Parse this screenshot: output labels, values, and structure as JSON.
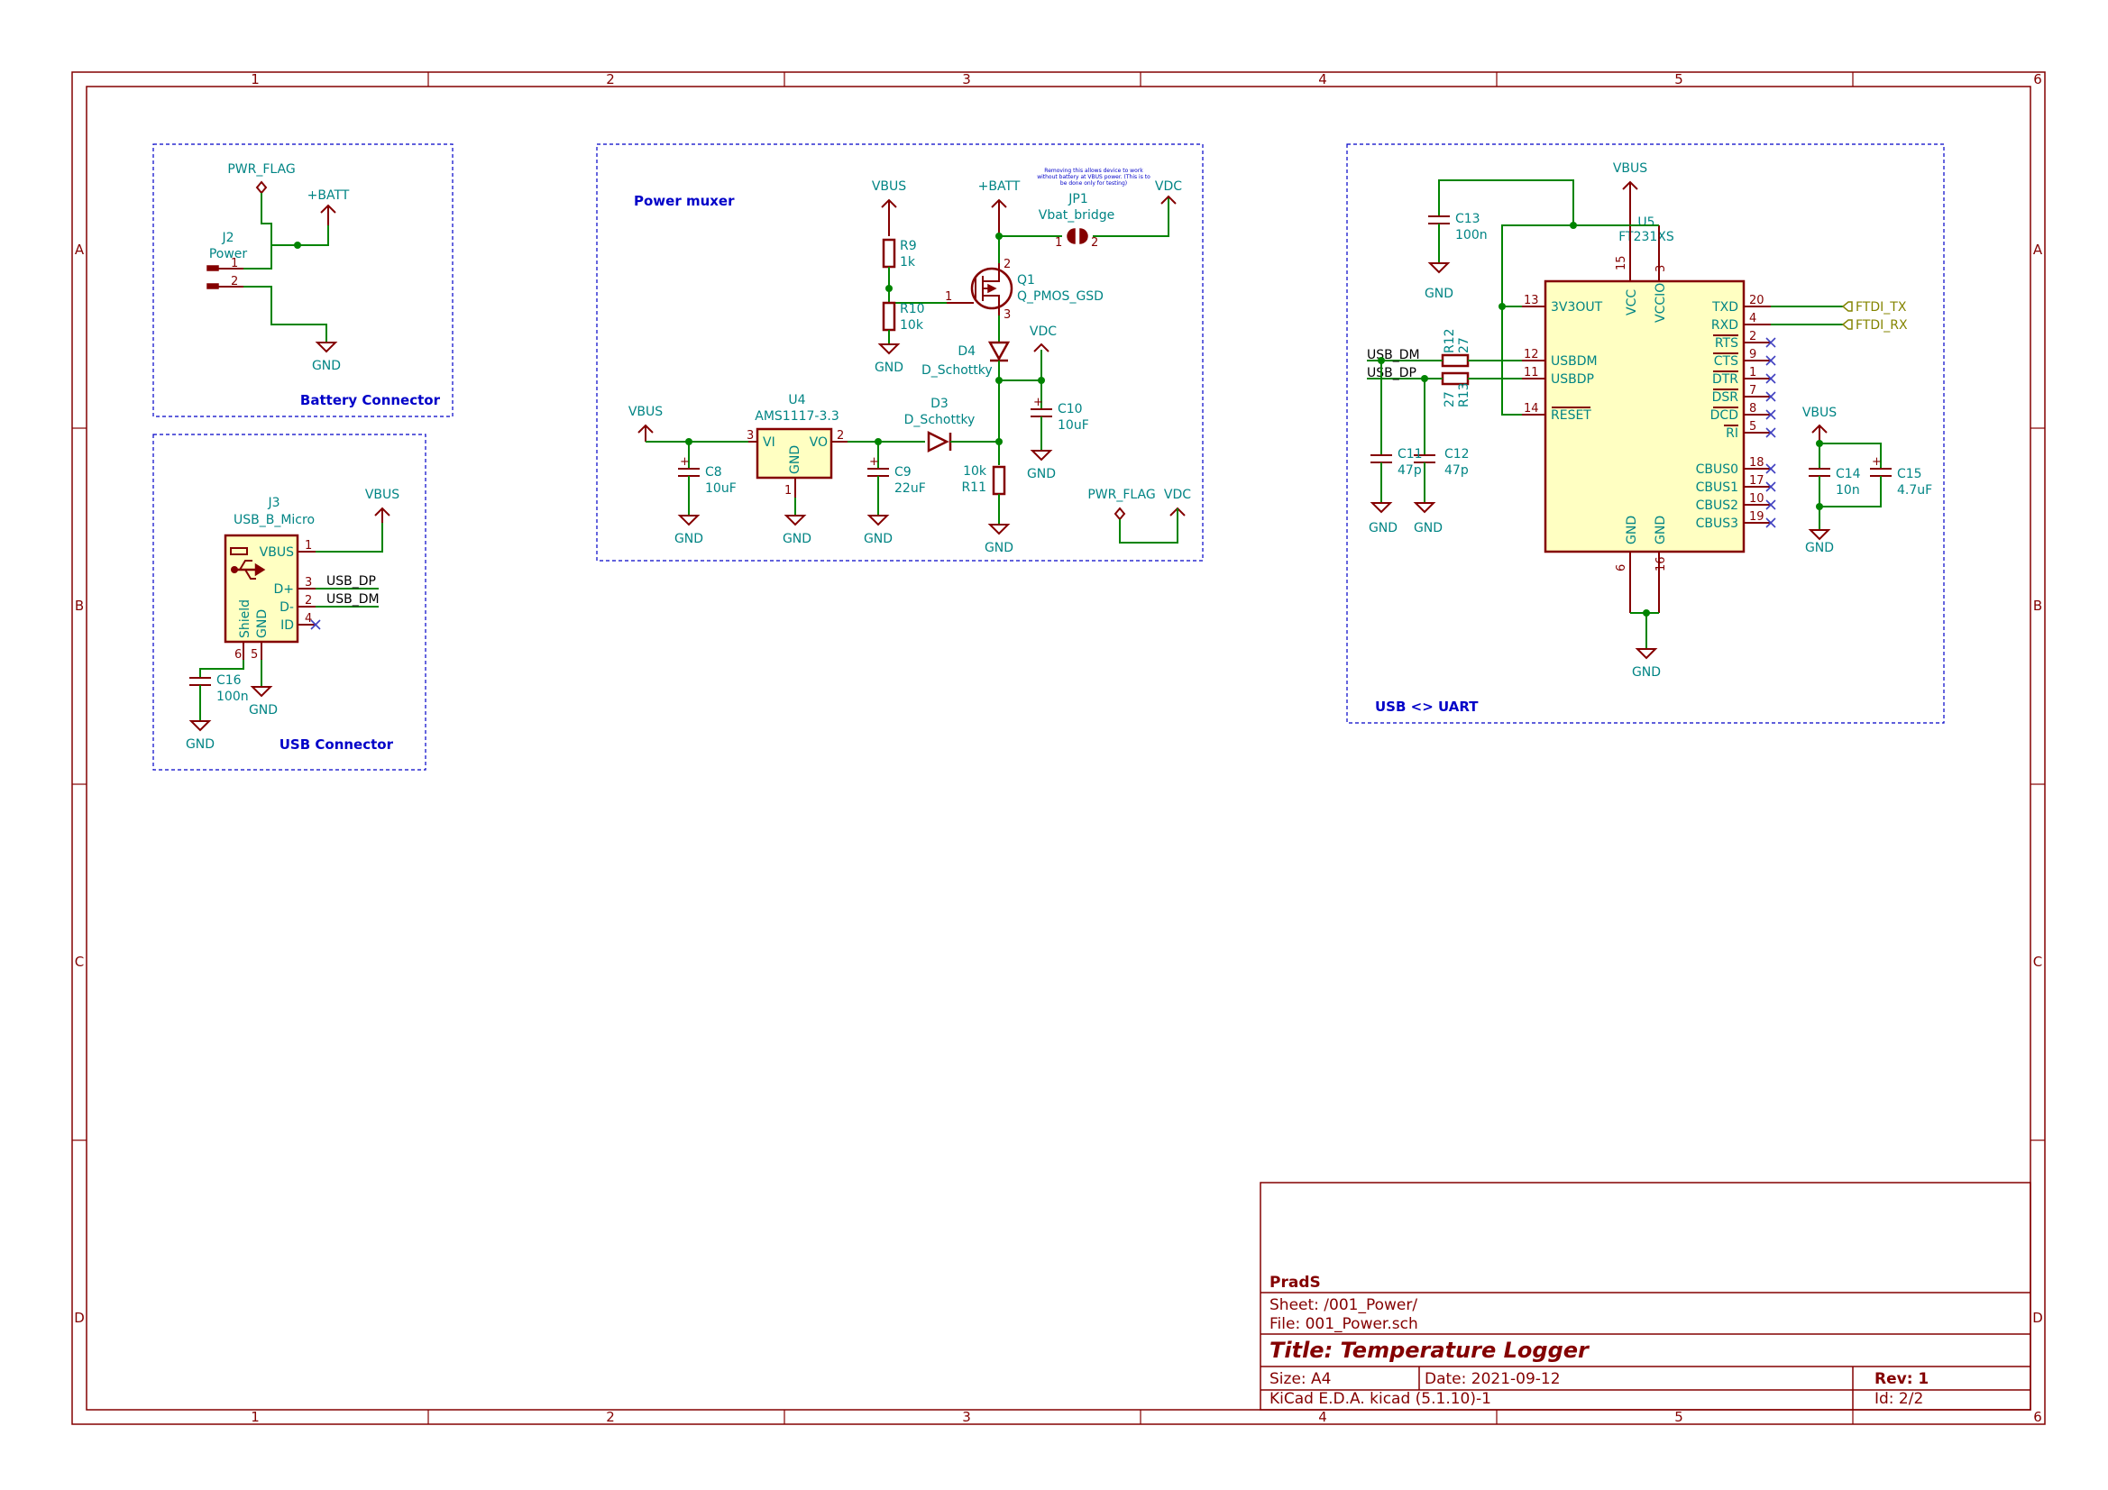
{
  "page": {
    "columns": [
      "1",
      "2",
      "3",
      "4",
      "5",
      "6"
    ],
    "rows": [
      "A",
      "B",
      "C",
      "D"
    ]
  },
  "sections": {
    "battery": "Battery Connector",
    "usb": "USB Connector",
    "power": "Power muxer",
    "uart": "USB <> UART"
  },
  "battery": {
    "pwrflag": "PWR_FLAG",
    "batt": "+BATT",
    "j2_ref": "J2",
    "j2_val": "Power",
    "pin1": "1",
    "pin2": "2",
    "gnd": "GND"
  },
  "usbconn": {
    "j3_ref": "J3",
    "j3_val": "USB_B_Micro",
    "vbus_pin": "VBUS",
    "dp_pin": "D+",
    "dm_pin": "D-",
    "id_pin": "ID",
    "gnd_pin": "GND",
    "shield_pin": "Shield",
    "p1": "1",
    "p2": "2",
    "p3": "3",
    "p4": "4",
    "p5": "5",
    "p6": "6",
    "usb_dp": "USB_DP",
    "usb_dm": "USB_DM",
    "vbus": "VBUS",
    "c16_ref": "C16",
    "c16_val": "100n",
    "gnd": "GND"
  },
  "power": {
    "note": "Removing this allows device to work without battery at VBUS power. (This is to be done only for testing)",
    "vbus": "VBUS",
    "batt": "+BATT",
    "vdc": "VDC",
    "jp1_ref": "JP1",
    "jp1_val": "Vbat_bridge",
    "r9_ref": "R9",
    "r9_val": "1k",
    "r10_ref": "R10",
    "r10_val": "10k",
    "q1_ref": "Q1",
    "q1_val": "Q_PMOS_GSD",
    "d4_ref": "D4",
    "d4_val": "D_Schottky",
    "d3_ref": "D3",
    "d3_val": "D_Schottky",
    "u4_ref": "U4",
    "u4_val": "AMS1117-3.3",
    "vi": "VI",
    "vo": "VO",
    "u4_gnd": "GND",
    "c8_ref": "C8",
    "c8_val": "10uF",
    "c9_ref": "C9",
    "c9_val": "22uF",
    "c10_ref": "C10",
    "c10_val": "10uF",
    "r11_ref": "R11",
    "r11_val": "10k",
    "pwrflag": "PWR_FLAG",
    "gnd": "GND",
    "n1": "1",
    "n2": "2",
    "n3": "3"
  },
  "uart": {
    "vbus": "VBUS",
    "c13_ref": "C13",
    "c13_val": "100n",
    "u5_ref": "U5",
    "u5_val": "FT231XS",
    "pin_3v3": "3V3OUT",
    "pin_vcc": "VCC",
    "pin_vccio": "VCCIO",
    "pin_usbdm": "USBDM",
    "pin_usbdp": "USBDP",
    "pin_reset": "RESET",
    "pin_gnd": "GND",
    "right_pins": [
      {
        "name": "TXD",
        "num": "20"
      },
      {
        "name": "RXD",
        "num": "4"
      },
      {
        "name": "RTS",
        "num": "2"
      },
      {
        "name": "CTS",
        "num": "9"
      },
      {
        "name": "DTR",
        "num": "1"
      },
      {
        "name": "DSR",
        "num": "7"
      },
      {
        "name": "DCD",
        "num": "8"
      },
      {
        "name": "RI",
        "num": "5"
      }
    ],
    "cbus_pins": [
      {
        "name": "CBUS0",
        "num": "18"
      },
      {
        "name": "CBUS1",
        "num": "17"
      },
      {
        "name": "CBUS2",
        "num": "10"
      },
      {
        "name": "CBUS3",
        "num": "19"
      }
    ],
    "n13": "13",
    "n12": "12",
    "n11": "11",
    "n14": "14",
    "n15": "15",
    "n3": "3",
    "n6": "6",
    "n16": "16",
    "ftdi_tx": "FTDI_TX",
    "ftdi_rx": "FTDI_RX",
    "usb_dm": "USB_DM",
    "usb_dp": "USB_DP",
    "r12_ref": "R12",
    "r12_val": "27",
    "r13_ref": "R13",
    "r13_val": "27",
    "c11_ref": "C11",
    "c11_val": "47p",
    "c12_ref": "C12",
    "c12_val": "47p",
    "c14_ref": "C14",
    "c14_val": "10n",
    "c15_ref": "C15",
    "c15_val": "4.7uF",
    "gnd": "GND"
  },
  "title_block": {
    "company": "PradS",
    "sheet": "Sheet: /001_Power/",
    "file": "File: 001_Power.sch",
    "title": "Title: Temperature Logger",
    "size": "Size: A4",
    "date": "Date: 2021-09-12",
    "rev": "Rev: 1",
    "tool": "KiCad E.D.A.  kicad (5.1.10)-1",
    "id": "Id: 2/2"
  },
  "colors": {
    "frame": "#840000",
    "wire": "#008400",
    "component_fill": "#ffffc2",
    "section_border": "#0000c8",
    "text_teal": "#008484"
  }
}
